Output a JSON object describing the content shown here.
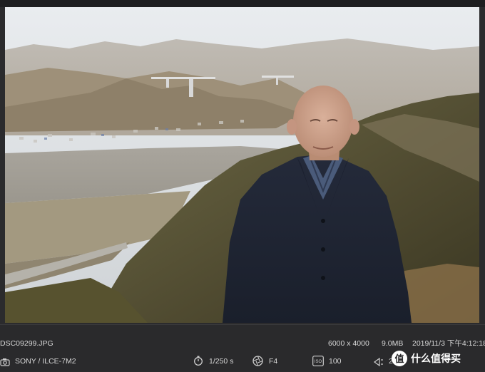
{
  "photo": {
    "filename": "DSC09299.JPG",
    "dimensions": "6000 x 4000",
    "file_size": "9.0MB",
    "datetime": "2019/11/3 下午4:12:18"
  },
  "exif": {
    "camera": "SONY / ILCE-7M2",
    "shutter": "1/250 s",
    "aperture": "F4",
    "iso": "100",
    "focal_length": "26"
  },
  "watermark": {
    "text": "什么值得买"
  },
  "icons": {
    "camera": "camera-icon",
    "shutter": "timer-icon",
    "aperture": "aperture-icon",
    "iso": "iso-icon",
    "focal": "lens-icon"
  }
}
